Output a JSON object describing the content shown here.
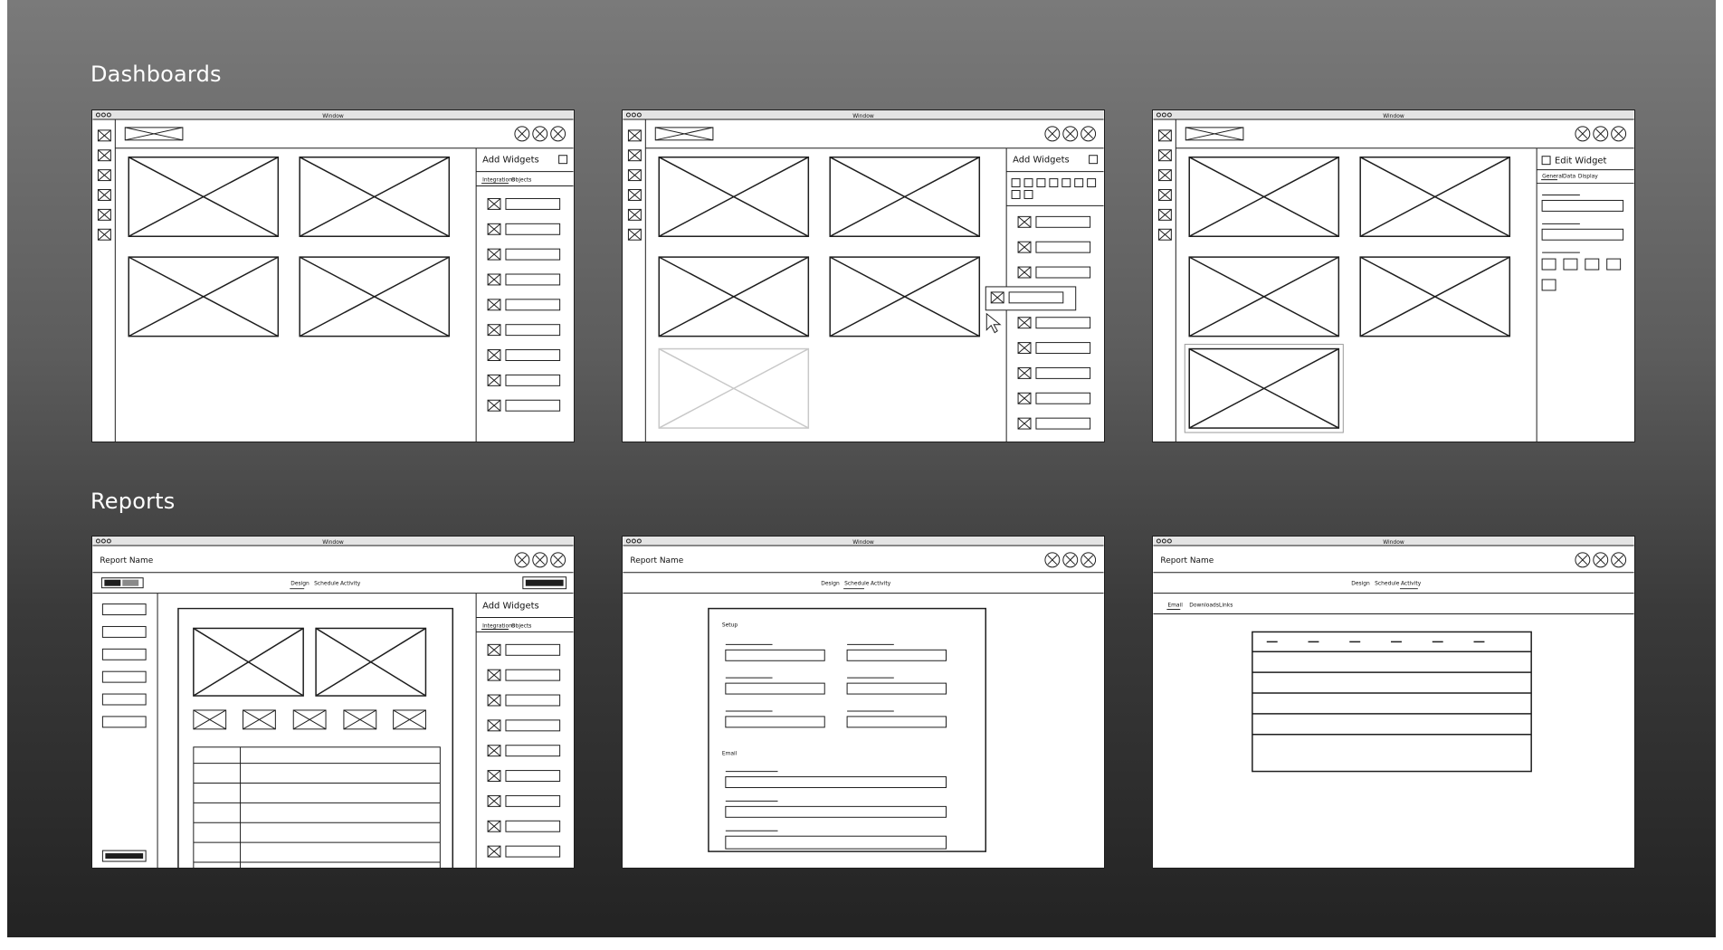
{
  "sections": {
    "dashboards": {
      "title": "Dashboards"
    },
    "reports": {
      "title": "Reports"
    }
  },
  "window": {
    "title": "Window"
  },
  "dashboard_frames": [
    {
      "panel_title": "Add Widgets",
      "tabs": [
        "Integrations",
        "Objects"
      ]
    },
    {
      "panel_title": "Add Widgets"
    },
    {
      "panel_title": "Edit Widget",
      "tabs": [
        "General",
        "Data",
        "Display"
      ]
    }
  ],
  "report_frames": [
    {
      "report_name": "Report Name",
      "tabs": [
        "Design",
        "Schedule",
        "Activity"
      ],
      "active_tab": "Design",
      "panel_title": "Add Widgets",
      "panel_tabs": [
        "Integrations",
        "Objects"
      ]
    },
    {
      "report_name": "Report Name",
      "tabs": [
        "Design",
        "Schedule",
        "Activity"
      ],
      "active_tab": "Schedule",
      "labels": {
        "setup": "Setup",
        "email": "Email"
      }
    },
    {
      "report_name": "Report Name",
      "tabs": [
        "Design",
        "Schedule",
        "Activity"
      ],
      "active_tab": "Activity",
      "subtabs": [
        "Email",
        "Downloads",
        "Links"
      ]
    }
  ],
  "colors": {
    "stroke": "#1e1e1e",
    "ghost": "#c8c8c8",
    "titlebar": "#e4e4e4"
  }
}
